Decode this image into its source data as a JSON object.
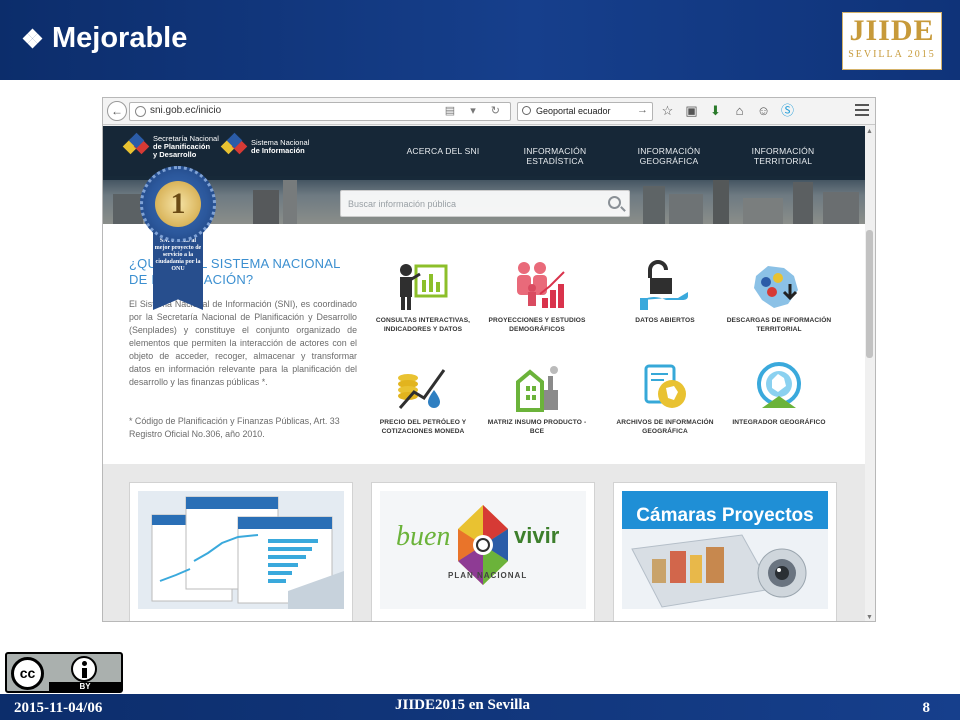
{
  "slide": {
    "title": "Mejorable",
    "logo_text": "JIIDE",
    "logo_subtext": "SEVILLA 2015",
    "footer_date": "2015-11-04/06",
    "footer_event": "JIIDE2015 en Sevilla",
    "page_number": "8",
    "license_cc": "cc",
    "license_by": "BY"
  },
  "browser": {
    "url": "sni.gob.ec/inicio",
    "search_value": "Geoportal ecuador",
    "toolbar_icons": [
      "bookmark-star-icon",
      "clipboard-icon",
      "download-icon",
      "home-icon",
      "chat-icon",
      "skype-icon"
    ]
  },
  "site": {
    "logo1": [
      "Secretaría Nacional",
      "de Planificación",
      "y Desarrollo"
    ],
    "logo2": [
      "Sistema Nacional",
      "de Información"
    ],
    "nav": [
      {
        "label": "ACERCA DEL SNI"
      },
      {
        "label": "INFORMACIÓN ESTADÍSTICA"
      },
      {
        "label": "INFORMACIÓN GEOGRÁFICA"
      },
      {
        "label": "INFORMACIÓN TERRITORIAL"
      }
    ],
    "search_placeholder": "Buscar información pública",
    "award": {
      "number": "1",
      "text": "SNI Premio al mejor proyecto de servicio a la ciudadanía por la ONU"
    },
    "heading": "¿QUÉ ES EL SISTEMA NACIONAL DE INFORMACIÓN?",
    "paragraph": "El Sistema Nacional de Información (SNI), es coordinado por la Secretaría Nacional de Planificación y Desarrollo (Senplades) y constituye el conjunto organizado de elementos que permiten la interacción de actores con el objeto de acceder, recoger, almacenar y transformar datos en información relevante para la planificación del desarrollo y las finanzas públicas *.",
    "note": "* Código de Planificación y Finanzas Públicas, Art. 33 Registro Oficial No.306, año 2010.",
    "tiles": [
      {
        "label": "CONSULTAS INTERACTIVAS, INDICADORES Y DATOS"
      },
      {
        "label": "PROYECCIONES Y ESTUDIOS DEMOGRÁFICOS"
      },
      {
        "label": "DATOS ABIERTOS"
      },
      {
        "label": "DESCARGAS DE INFORMACIÓN TERRITORIAL"
      },
      {
        "label": "PRECIO DEL PETRÓLEO Y COTIZACIONES MONEDA"
      },
      {
        "label": "MATRIZ INSUMO PRODUCTO - BCE"
      },
      {
        "label": "ARCHIVOS DE INFORMACIÓN GEOGRÁFICA"
      },
      {
        "label": "INTEGRADOR GEOGRÁFICO"
      }
    ],
    "cards": {
      "buen": "buen",
      "vivir": "vivir",
      "plan": "PLAN NACIONAL",
      "camaras": "Cámaras Proyectos"
    }
  },
  "colors": {
    "slide_blue": "#163f8c",
    "heading_blue": "#3b8fd0",
    "site_nav": "#1e2a36"
  }
}
